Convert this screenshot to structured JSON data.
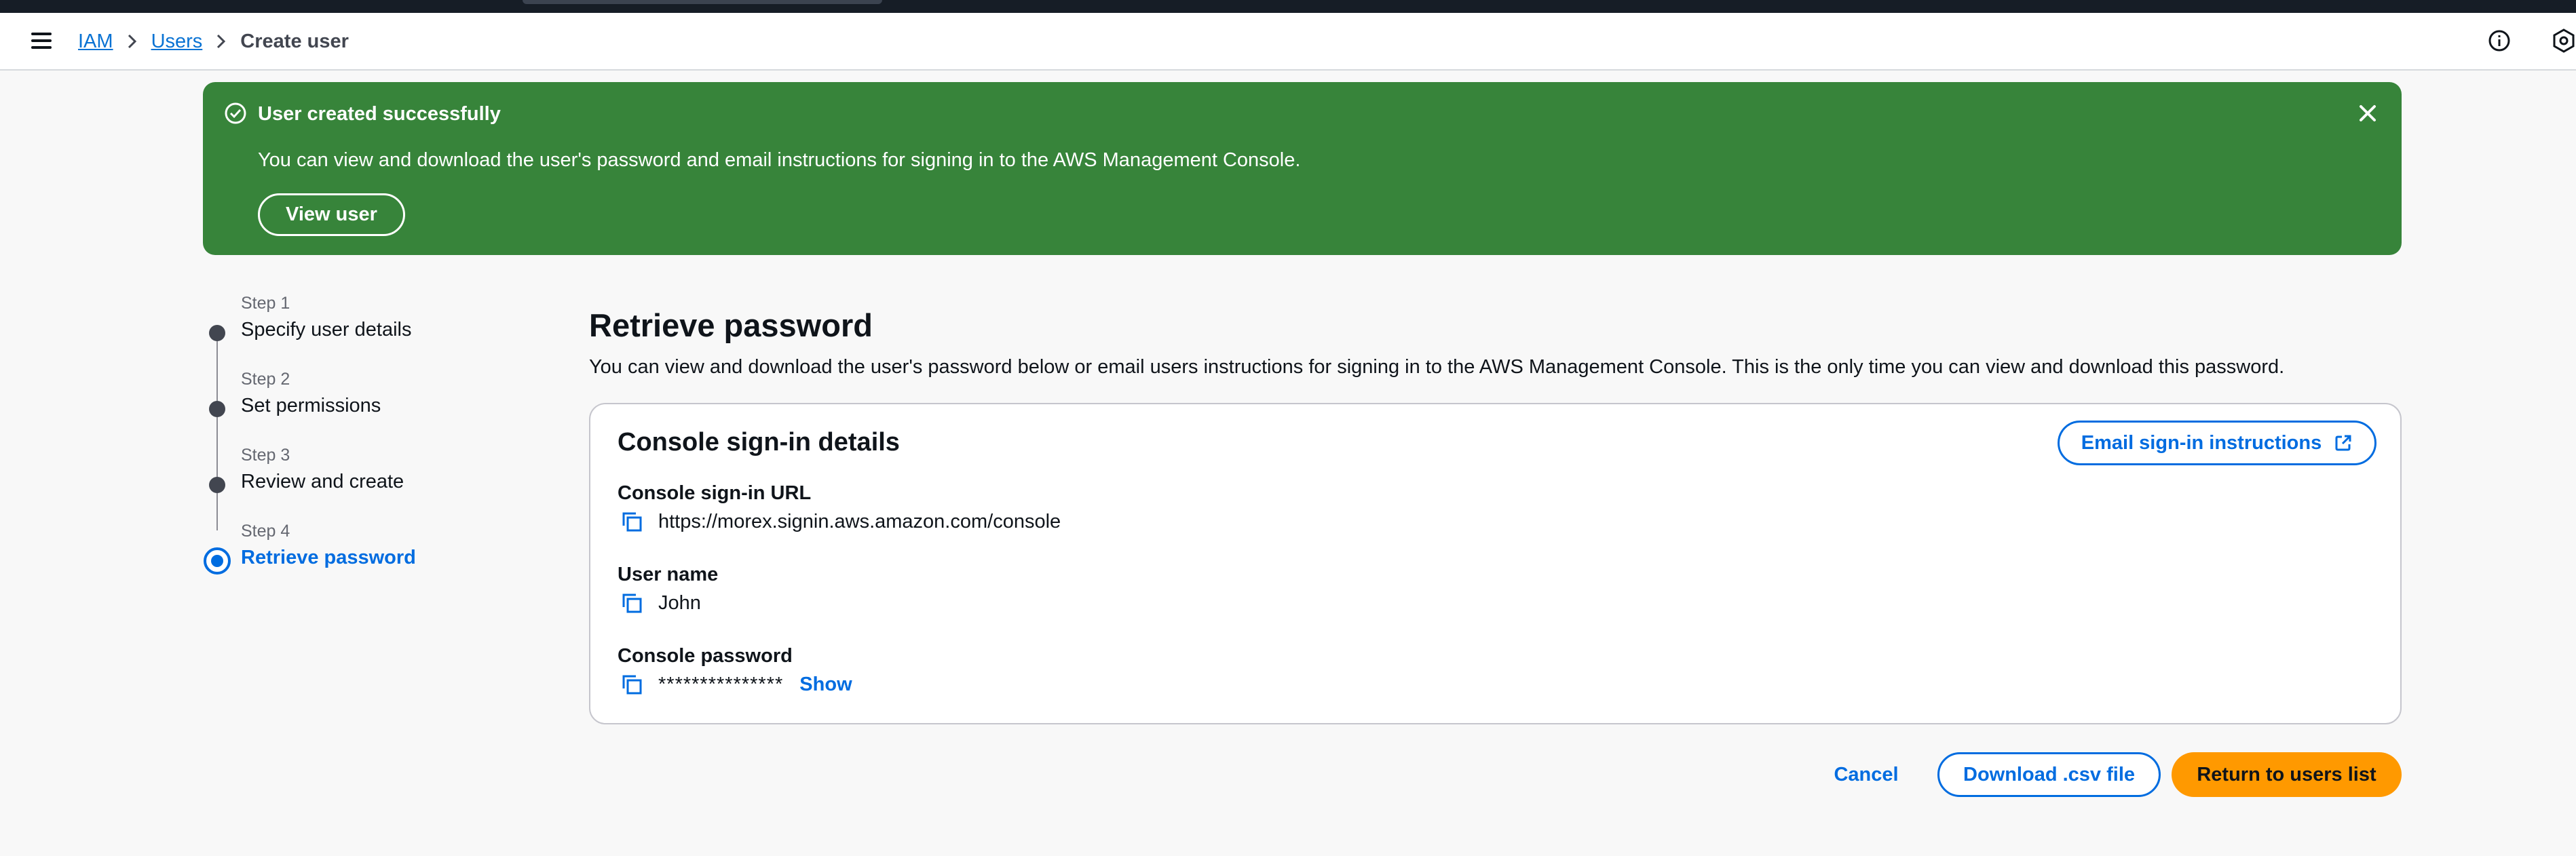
{
  "breadcrumb": {
    "items": [
      {
        "label": "IAM"
      },
      {
        "label": "Users"
      },
      {
        "label": "Create user"
      }
    ]
  },
  "flash": {
    "title": "User created successfully",
    "message": "You can view and download the user's password and email instructions for signing in to the AWS Management Console.",
    "button_label": "View user",
    "color": "#37843a"
  },
  "steps": [
    {
      "number": "Step 1",
      "title": "Specify user details"
    },
    {
      "number": "Step 2",
      "title": "Set permissions"
    },
    {
      "number": "Step 3",
      "title": "Review and create"
    },
    {
      "number": "Step 4",
      "title": "Retrieve password",
      "active": true
    }
  ],
  "main": {
    "title": "Retrieve password",
    "description": "You can view and download the user's password below or email users instructions for signing in to the AWS Management Console. This is the only time you can view and download this password."
  },
  "card": {
    "title": "Console sign-in details",
    "email_button_label": "Email sign-in instructions",
    "fields": {
      "url": {
        "label": "Console sign-in URL",
        "value": "https://morex.signin.aws.amazon.com/console"
      },
      "username": {
        "label": "User name",
        "value": "John"
      },
      "password": {
        "label": "Console password",
        "value": "***************",
        "show_label": "Show"
      }
    }
  },
  "actions": {
    "cancel_label": "Cancel",
    "download_label": "Download .csv file",
    "return_label": "Return to users list"
  },
  "colors": {
    "accent": "#006ce0",
    "primary_button": "#ff9900",
    "success": "#37843a"
  }
}
